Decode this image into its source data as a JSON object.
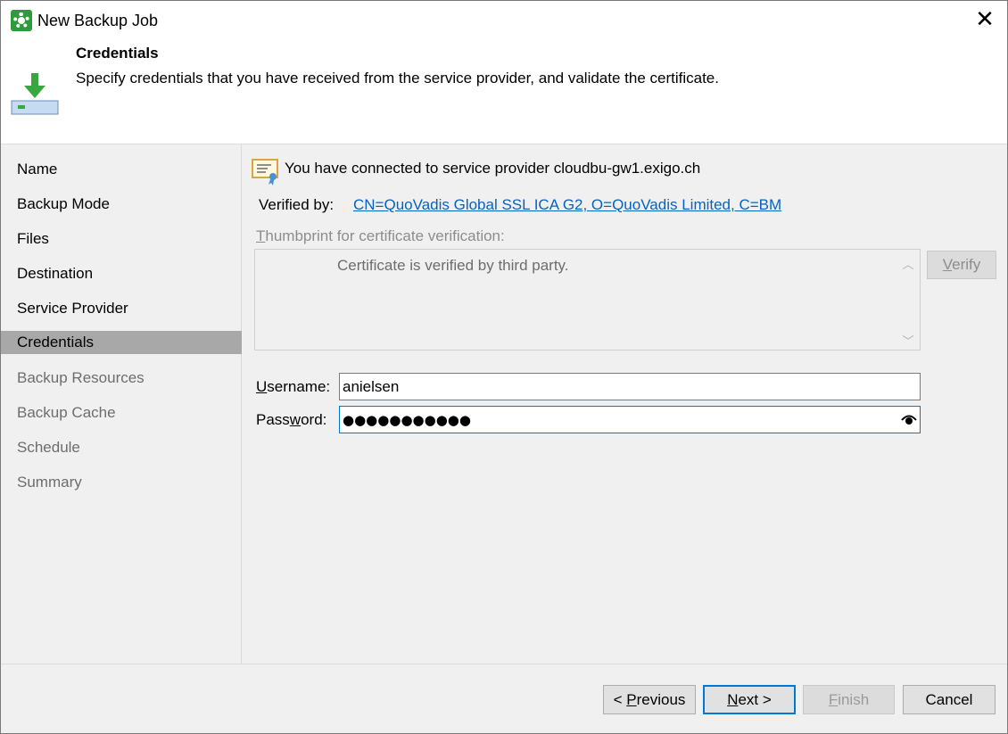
{
  "window": {
    "title": "New Backup Job",
    "close_icon": "close-icon"
  },
  "header": {
    "title": "Credentials",
    "description": "Specify credentials that you have received from the service provider, and validate the certificate."
  },
  "sidebar": {
    "items": [
      {
        "label": "Name",
        "state": "enabled"
      },
      {
        "label": "Backup Mode",
        "state": "enabled"
      },
      {
        "label": "Files",
        "state": "enabled"
      },
      {
        "label": "Destination",
        "state": "enabled"
      },
      {
        "label": "Service Provider",
        "state": "enabled"
      },
      {
        "label": "Credentials",
        "state": "active"
      },
      {
        "label": "Backup Resources",
        "state": "disabled"
      },
      {
        "label": "Backup Cache",
        "state": "disabled"
      },
      {
        "label": "Schedule",
        "state": "disabled"
      },
      {
        "label": "Summary",
        "state": "disabled"
      }
    ]
  },
  "content": {
    "connected_text": "You have connected to service provider cloudbu-gw1.exigo.ch",
    "verified_label": "Verified by:",
    "verified_link": "CN=QuoVadis Global SSL ICA G2, O=QuoVadis Limited, C=BM",
    "thumbprint_label_first": "T",
    "thumbprint_label_rest": "humbprint for certificate verification:",
    "thumbprint_text": "Certificate is verified by third party.",
    "verify_first": "V",
    "verify_rest": "erify",
    "username_label_first": "U",
    "username_label_rest": "sername:",
    "username_value": "anielsen",
    "password_label_pre": "Pass",
    "password_label_key": "w",
    "password_label_post": "ord:",
    "password_masked": "●●●●●●●●●●●"
  },
  "footer": {
    "previous_pre": "< ",
    "previous_key": "P",
    "previous_rest": "revious",
    "next_key": "N",
    "next_rest": "ext >",
    "finish_key": "F",
    "finish_rest": "inish",
    "cancel": "Cancel"
  },
  "colors": {
    "link": "#0563c1",
    "accent": "#0078d7",
    "active_nav": "#a8a8a8",
    "brand_green": "#2e9a3a"
  }
}
